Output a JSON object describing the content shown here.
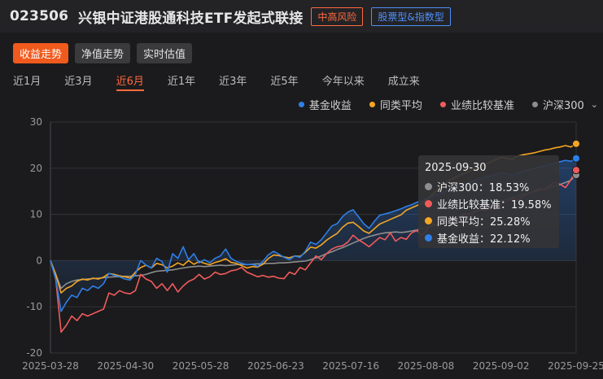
{
  "header": {
    "code": "023506",
    "name": "兴银中证港股通科技ETF发起式联接",
    "risk_badge": "中高风险",
    "type_badge": "股票型&指数型"
  },
  "view_tabs": [
    {
      "label": "收益走势",
      "active": true
    },
    {
      "label": "净值走势",
      "active": false
    },
    {
      "label": "实时估值",
      "active": false
    }
  ],
  "period_tabs": [
    {
      "label": "近1月",
      "active": false
    },
    {
      "label": "近3月",
      "active": false
    },
    {
      "label": "近6月",
      "active": true
    },
    {
      "label": "近1年",
      "active": false
    },
    {
      "label": "近3年",
      "active": false
    },
    {
      "label": "近5年",
      "active": false
    },
    {
      "label": "今年以来",
      "active": false
    },
    {
      "label": "成立来",
      "active": false
    }
  ],
  "legend": [
    {
      "label": "基金收益",
      "color": "#2f7fe8"
    },
    {
      "label": "同类平均",
      "color": "#f5a623"
    },
    {
      "label": "业绩比较基准",
      "color": "#f25b5b"
    },
    {
      "label": "沪深300",
      "color": "#8e8e8e",
      "has_dropdown": true
    }
  ],
  "tooltip": {
    "date": "2025-09-30",
    "rows": [
      {
        "label": "沪深300：18.53%",
        "color": "#8e8e8e"
      },
      {
        "label": "业绩比较基准：19.58%",
        "color": "#f25b5b"
      },
      {
        "label": "同类平均：25.28%",
        "color": "#f5a623"
      },
      {
        "label": "基金收益：22.12%",
        "color": "#2f7fe8"
      }
    ]
  },
  "chart_data": {
    "type": "line",
    "ylim": [
      -20,
      30
    ],
    "yticks": [
      30,
      20,
      10,
      0,
      -10,
      -20
    ],
    "xtick_labels": [
      "2025-03-28",
      "2025-04-30",
      "2025-05-28",
      "2025-06-23",
      "2025-07-16",
      "2025-08-08",
      "2025-09-02",
      "2025-09-25"
    ],
    "x_points": 100,
    "series": [
      {
        "name": "沪深300",
        "color": "#8e8e8e",
        "values": [
          0,
          -3,
          -6,
          -5,
          -4.5,
          -4.2,
          -4.1,
          -4,
          -3.9,
          -3.8,
          -3.7,
          -3.6,
          -3.5,
          -3.5,
          -3.4,
          -3.4,
          -3.3,
          -3.2,
          -3,
          -2.6,
          -2.3,
          -2.2,
          -2.1,
          -2,
          -1.8,
          -1.6,
          -1.4,
          -1.3,
          -1.2,
          -1.3,
          -1.2,
          -1.1,
          -1,
          -1.1,
          -1,
          -0.9,
          -0.8,
          -0.9,
          -0.8,
          -0.7,
          -0.7,
          -0.6,
          -0.6,
          -0.5,
          -0.5,
          -0.4,
          -0.3,
          -0.2,
          -0.1,
          0.2,
          0.6,
          1,
          1.5,
          1.9,
          2.4,
          2.8,
          3.3,
          3.8,
          4.3,
          4.8,
          5.2,
          5.5,
          5.8,
          6,
          6.1,
          6.2,
          6.1,
          6.2,
          6.4,
          6.6,
          6.9,
          7.2,
          7.5,
          7.9,
          8.2,
          8.6,
          9,
          9.4,
          9.8,
          10.3,
          10.8,
          11.2,
          11.6,
          12.1,
          12.5,
          12.9,
          13.3,
          13.6,
          14,
          14.3,
          14.6,
          14.9,
          15.2,
          15.5,
          15.8,
          16.1,
          16.5,
          16.9,
          17.4,
          18.53
        ]
      },
      {
        "name": "业绩比较基准",
        "color": "#f25b5b",
        "values": [
          0,
          -4,
          -15.5,
          -14,
          -12,
          -13,
          -11.5,
          -12,
          -11.5,
          -11,
          -10.5,
          -7,
          -7.5,
          -6.5,
          -7,
          -7.2,
          -6.5,
          -3,
          -4,
          -4.5,
          -6,
          -5,
          -6.5,
          -5,
          -6.8,
          -5.5,
          -4.5,
          -4,
          -3,
          -4,
          -3.5,
          -2.5,
          -3,
          -2.8,
          -2.2,
          -2,
          -1.5,
          -2.5,
          -3,
          -3.5,
          -3.2,
          -3.6,
          -3.4,
          -3.8,
          -3.9,
          -2.5,
          -3,
          -1.5,
          -2,
          -0.5,
          1,
          0.2,
          1.5,
          2.5,
          3,
          3.2,
          4,
          5.5,
          4.5,
          3.8,
          3,
          4,
          5,
          4.5,
          6,
          4.2,
          5,
          4.6,
          6,
          6.5,
          5.5,
          6.8,
          8,
          7.5,
          8.6,
          9,
          8.2,
          9.5,
          10.2,
          9.8,
          10.5,
          11,
          10.8,
          11.8,
          11,
          12.3,
          12.8,
          13.5,
          13,
          14,
          14.5,
          15,
          15.6,
          15.2,
          16.2,
          17,
          16.5,
          15.8,
          17.5,
          19.58
        ]
      },
      {
        "name": "同类平均",
        "color": "#f5a623",
        "values": [
          0,
          -3,
          -7,
          -6,
          -5.5,
          -4.5,
          -4,
          -4.2,
          -3.8,
          -4,
          -3.6,
          -2.8,
          -3,
          -3.3,
          -3.5,
          -3.8,
          -2.5,
          -1.5,
          -1,
          -1.6,
          -0.6,
          -0.9,
          -1.6,
          -1.2,
          -0.5,
          -1,
          0,
          -0.8,
          -0.2,
          -0.6,
          -0.9,
          -0.4,
          -0.1,
          0.4,
          -0.4,
          -0.6,
          -1.1,
          -1.6,
          -1.3,
          -1.4,
          -0.8,
          0.4,
          1.2,
          1.1,
          0.8,
          0.6,
          1,
          0.9,
          1.8,
          2.9,
          2.7,
          3.4,
          4.4,
          5.2,
          5.9,
          7.2,
          8.1,
          8.3,
          7.4,
          6.4,
          5.9,
          6.9,
          7.9,
          8.4,
          8.9,
          9.4,
          9.9,
          10.9,
          11.4,
          11.9,
          12.4,
          13.4,
          14.4,
          15.4,
          16.4,
          17.4,
          17.9,
          18.4,
          18.9,
          19.4,
          19.9,
          20.4,
          20.9,
          21.4,
          21.9,
          22.4,
          22.1,
          21.9,
          22.6,
          22.9,
          23.1,
          23.3,
          23.6,
          23.9,
          24.1,
          24.4,
          24.6,
          24.9,
          24.6,
          25.28
        ]
      },
      {
        "name": "基金收益",
        "color": "#2f7fe8",
        "values": [
          0,
          -4,
          -11,
          -9,
          -7.5,
          -8,
          -6,
          -6.5,
          -5.5,
          -6,
          -5,
          -2.8,
          -3.2,
          -3.5,
          -4,
          -4.2,
          -3,
          0,
          -1,
          -1.6,
          0.5,
          -0.2,
          -2.5,
          1.5,
          0.5,
          3,
          0.2,
          1.5,
          -0.5,
          0.2,
          -0.5,
          0.5,
          1,
          2.5,
          0.5,
          -0.2,
          -0.6,
          -0.9,
          -0.8,
          -1.3,
          -0.2,
          1.2,
          2,
          1.4,
          0.7,
          0.2,
          1,
          0.7,
          2,
          4,
          3.5,
          4.5,
          6,
          7.5,
          8,
          9.5,
          10.5,
          11,
          9.5,
          8,
          7,
          8.5,
          9.8,
          10.1,
          10.4,
          10.8,
          11.2,
          11.7,
          12.1,
          12.6,
          13,
          13.5,
          14,
          14.4,
          14.8,
          15.3,
          15.7,
          16.1,
          16.5,
          17,
          17.4,
          17.8,
          18.1,
          18.4,
          18.7,
          19,
          18.8,
          18.5,
          19,
          19.3,
          19.6,
          19.9,
          20.2,
          20.5,
          20.8,
          21.1,
          21.4,
          21.7,
          21.5,
          22.12
        ]
      }
    ]
  }
}
